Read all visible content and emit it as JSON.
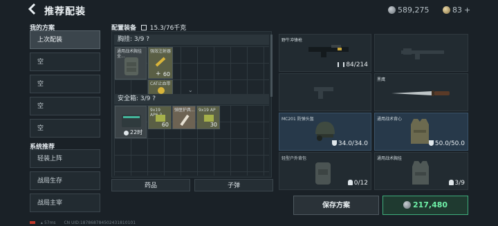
{
  "header": {
    "back_icon": "back-arrow-icon",
    "title": "推荐配装",
    "currency_silver": "589,275",
    "currency_gold": "83",
    "plus": "+"
  },
  "sidebar": {
    "my_plans_title": "我的方案",
    "my_plans": [
      "上次配装",
      "空",
      "空",
      "空",
      "空"
    ],
    "system_title": "系统推荐",
    "system": [
      "轻装上阵",
      "战局生存",
      "战局主宰"
    ]
  },
  "loadout": {
    "title": "配置装备",
    "weight_icon": "weight-lock-icon",
    "weight": "15.3/76千克"
  },
  "chest_rig": {
    "header": "胸挂: 3/9 ?",
    "items": [
      {
        "label": "通用战术胸挂 全...",
        "count": ""
      },
      {
        "label": "强效注射器",
        "count": "60"
      },
      {
        "label": "CAT止血带",
        "count": ""
      }
    ],
    "plus": "+"
  },
  "safe_box": {
    "header": "安全箱: 3/9 ?",
    "timer": "22时",
    "items": [
      {
        "label": "9x19 AP6.3",
        "count": "60"
      },
      {
        "label": "弹匣护具...",
        "count": ""
      },
      {
        "label": "9x19 AP",
        "count": "30"
      }
    ]
  },
  "tabs": {
    "medicine": "药品",
    "ammo": "子弹"
  },
  "slots": [
    {
      "label": "野牛冲锋枪",
      "value": "84/214",
      "icon": "ammo-icon"
    },
    {
      "label": "",
      "value": ""
    },
    {
      "label": "",
      "value": ""
    },
    {
      "label": "",
      "value": ""
    },
    {
      "label": "黑鹰",
      "value": ""
    },
    {
      "label": "MC201 防弹头盔",
      "value": "34.0/34.0",
      "icon": "shield-icon"
    },
    {
      "label": "通用战术背心",
      "value": "50.0/50.0",
      "icon": "shield-icon"
    },
    {
      "label": "轻型户外背包",
      "value": "0/12",
      "icon": "bag-icon"
    },
    {
      "label": "通用战术胸挂",
      "value": "3/9",
      "icon": "bag-icon"
    }
  ],
  "actions": {
    "save": "保存方案",
    "price": "217,480"
  },
  "footer": {
    "fps": "57ms",
    "uid": "CN UID:187868784502431810101"
  }
}
